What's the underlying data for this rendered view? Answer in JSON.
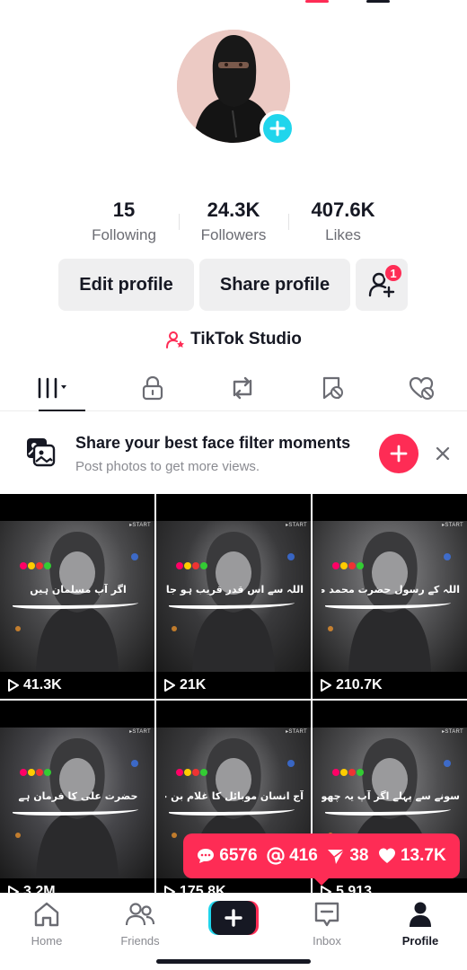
{
  "profile": {
    "avatar_alt": "profile-avatar",
    "stats": [
      {
        "value": "15",
        "label": "Following"
      },
      {
        "value": "24.3K",
        "label": "Followers"
      },
      {
        "value": "407.6K",
        "label": "Likes"
      }
    ],
    "edit_label": "Edit profile",
    "share_label": "Share profile",
    "friend_requests_count": "1",
    "studio_label": "TikTok Studio"
  },
  "tabs": [
    {
      "icon": "grid-icon",
      "active": true
    },
    {
      "icon": "lock-icon",
      "active": false
    },
    {
      "icon": "repost-icon",
      "active": false
    },
    {
      "icon": "favorites-icon",
      "active": false
    },
    {
      "icon": "liked-icon",
      "active": false
    }
  ],
  "banner": {
    "title": "Share your best face filter moments",
    "subtitle": "Post photos to get more views."
  },
  "videos": [
    {
      "views": "41.3K",
      "caption": "اگر آپ مسلمان ہیں"
    },
    {
      "views": "21K",
      "caption": "اللہ سے اس قدر قریب ہو جاؤ"
    },
    {
      "views": "210.7K",
      "caption": "اللہ کے رسول حضرت محمد صلی اللہ علیہ والہ وسلم نے فرمایا"
    },
    {
      "views": "3.2M",
      "caption": "حضرت علی کا فرمان ہے"
    },
    {
      "views": "175.8K",
      "caption": "آج انسان موبائل کا غلام بن چکا ہے"
    },
    {
      "views": "5,913",
      "caption": "سونے سے پہلے اگر آپ یہ چھوٹے عمل کریں گے"
    }
  ],
  "start_tag": "▸START",
  "engagement": {
    "comments": "6576",
    "mentions": "416",
    "shares": "38",
    "likes": "13.7K"
  },
  "navbar": {
    "home": "Home",
    "friends": "Friends",
    "inbox": "Inbox",
    "profile": "Profile"
  },
  "colors": {
    "accent": "#fe2c55",
    "cyan": "#20d5ec",
    "text": "#161823",
    "muted": "#8a8b91"
  }
}
